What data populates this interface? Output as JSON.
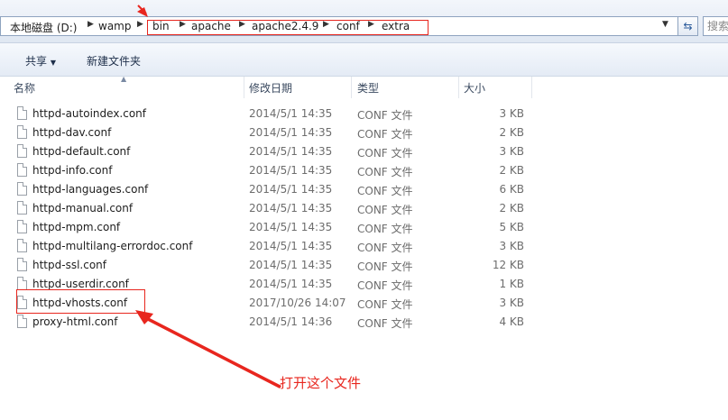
{
  "address_bar": {
    "crumbs": [
      "本地磁盘 (D:)",
      "wamp",
      "bin",
      "apache",
      "apache2.4.9",
      "conf",
      "extra"
    ],
    "search_placeholder": "搜索"
  },
  "toolbar": {
    "share_label": "共享",
    "new_folder_label": "新建文件夹"
  },
  "columns": {
    "name": "名称",
    "modified": "修改日期",
    "type": "类型",
    "size": "大小"
  },
  "files": [
    {
      "name": "httpd-autoindex.conf",
      "modified": "2014/5/1 14:35",
      "type": "CONF 文件",
      "size": "3 KB"
    },
    {
      "name": "httpd-dav.conf",
      "modified": "2014/5/1 14:35",
      "type": "CONF 文件",
      "size": "2 KB"
    },
    {
      "name": "httpd-default.conf",
      "modified": "2014/5/1 14:35",
      "type": "CONF 文件",
      "size": "3 KB"
    },
    {
      "name": "httpd-info.conf",
      "modified": "2014/5/1 14:35",
      "type": "CONF 文件",
      "size": "2 KB"
    },
    {
      "name": "httpd-languages.conf",
      "modified": "2014/5/1 14:35",
      "type": "CONF 文件",
      "size": "6 KB"
    },
    {
      "name": "httpd-manual.conf",
      "modified": "2014/5/1 14:35",
      "type": "CONF 文件",
      "size": "2 KB"
    },
    {
      "name": "httpd-mpm.conf",
      "modified": "2014/5/1 14:35",
      "type": "CONF 文件",
      "size": "5 KB"
    },
    {
      "name": "httpd-multilang-errordoc.conf",
      "modified": "2014/5/1 14:35",
      "type": "CONF 文件",
      "size": "3 KB"
    },
    {
      "name": "httpd-ssl.conf",
      "modified": "2014/5/1 14:35",
      "type": "CONF 文件",
      "size": "12 KB"
    },
    {
      "name": "httpd-userdir.conf",
      "modified": "2014/5/1 14:35",
      "type": "CONF 文件",
      "size": "1 KB"
    },
    {
      "name": "httpd-vhosts.conf",
      "modified": "2017/10/26 14:07",
      "type": "CONF 文件",
      "size": "3 KB"
    },
    {
      "name": "proxy-html.conf",
      "modified": "2014/5/1 14:36",
      "type": "CONF 文件",
      "size": "4 KB"
    }
  ],
  "annotation": {
    "text": "打开这个文件",
    "color": "#e8261e"
  }
}
